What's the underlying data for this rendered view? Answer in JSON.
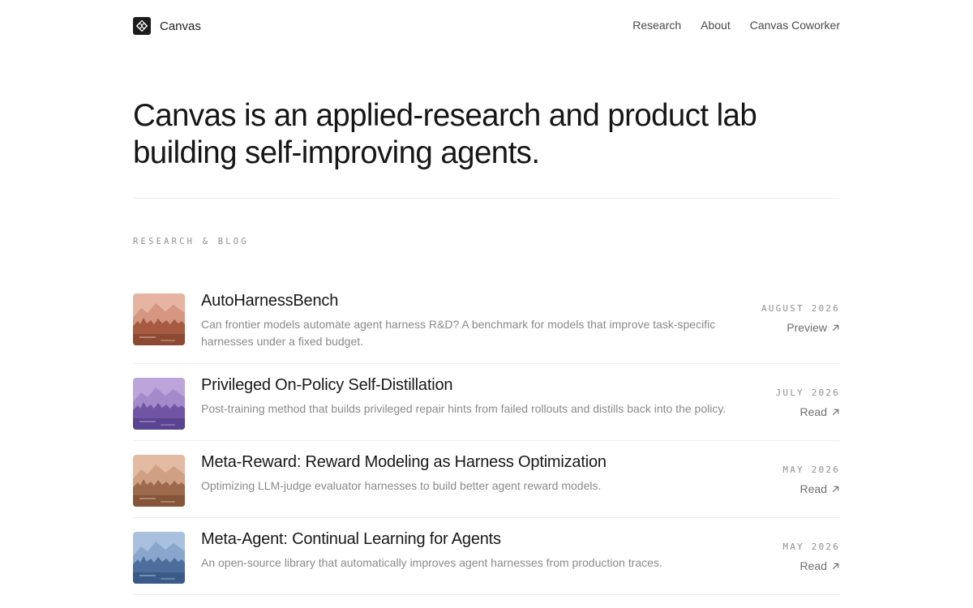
{
  "header": {
    "brand_name": "Canvas",
    "brand_icon": "canvas-logo-icon",
    "nav": [
      {
        "label": "Research"
      },
      {
        "label": "About"
      },
      {
        "label": "Canvas Coworker"
      }
    ]
  },
  "hero": {
    "headline_line1": "Canvas is an applied-research and product lab",
    "headline_line2": "building self-improving agents."
  },
  "section": {
    "label": "RESEARCH & BLOG"
  },
  "posts": [
    {
      "title": "AutoHarnessBench",
      "description": "Can frontier models automate agent harness R&D? A benchmark for models that improve task-specific harnesses under a fixed budget.",
      "date": "AUGUST 2026",
      "action": "Preview",
      "action_icon": "arrow-up-right-icon",
      "palette": {
        "sky": "#e6b5a1",
        "far": "#cf8e78",
        "near": "#a65a3f",
        "ground": "#8c4a34"
      }
    },
    {
      "title": "Privileged On-Policy Self-Distillation",
      "description": "Post-training method that builds privileged repair hints from failed rollouts and distills back into the policy.",
      "date": "JULY 2026",
      "action": "Read",
      "action_icon": "arrow-up-right-icon",
      "palette": {
        "sky": "#bba5db",
        "far": "#9c82c6",
        "near": "#6f55a3",
        "ground": "#5a4390"
      }
    },
    {
      "title": "Meta-Reward: Reward Modeling as Harness Optimization",
      "description": "Optimizing LLM-judge evaluator harnesses to build better agent reward models.",
      "date": "MAY 2026",
      "action": "Read",
      "action_icon": "arrow-up-right-icon",
      "palette": {
        "sky": "#e2bba2",
        "far": "#c9977a",
        "near": "#9c6a4b",
        "ground": "#845539"
      }
    },
    {
      "title": "Meta-Agent: Continual Learning for Agents",
      "description": "An open-source library that automatically improves agent harnesses from production traces.",
      "date": "MAY 2026",
      "action": "Read",
      "action_icon": "arrow-up-right-icon",
      "palette": {
        "sky": "#a9c1de",
        "far": "#7f9dc5",
        "near": "#4d6d9c",
        "ground": "#3b5a88"
      }
    }
  ]
}
